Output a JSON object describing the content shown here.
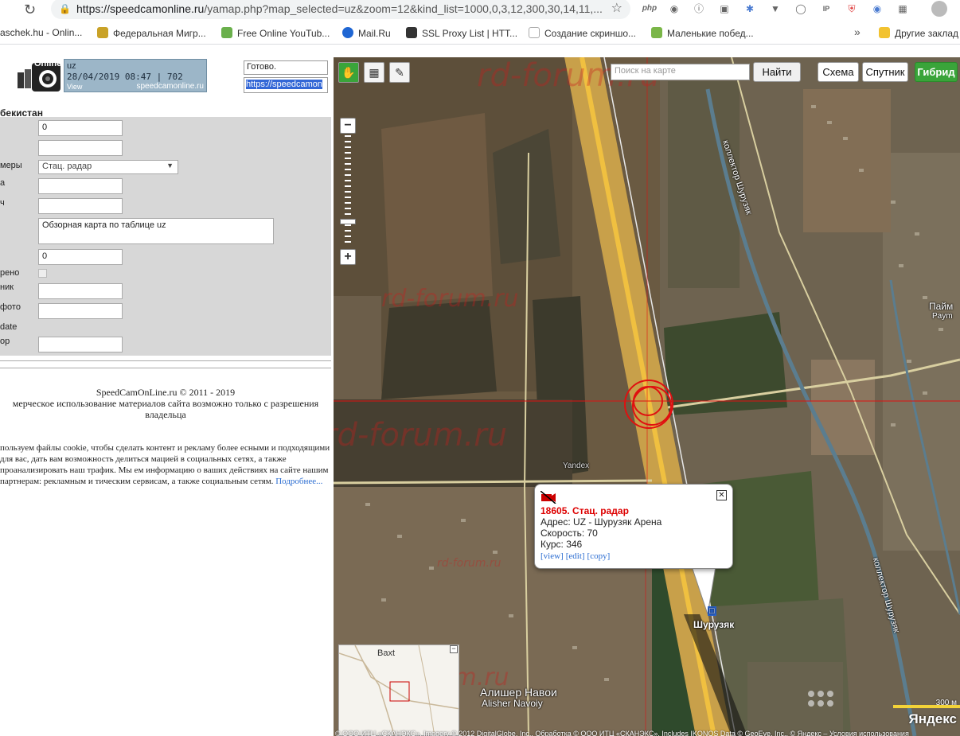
{
  "browser": {
    "url_domain": "https://speedcamonline.ru",
    "url_rest": "/yamap.php?map_selected=uz&zoom=12&kind_list=1000,0,3,12,300,30,14,11,...",
    "ext_php": "php",
    "bookmarks": [
      {
        "label": "aschek.hu - Onlin...",
        "color": "#d33"
      },
      {
        "label": "Федеральная Мигр...",
        "color": "#c9a227"
      },
      {
        "label": "Free Online YouTub...",
        "color": "#6ab04c"
      },
      {
        "label": "Mail.Ru",
        "color": "#1f66d3"
      },
      {
        "label": "SSL Proxy List | HTT...",
        "color": "#333"
      },
      {
        "label": "Создание скриншо...",
        "color": "#aaa"
      },
      {
        "label": "Маленькие побед...",
        "color": "#7ab648"
      },
      {
        "label": "Другие заклад",
        "color": "#f2c230"
      }
    ],
    "bookmarks_more": "»"
  },
  "panel": {
    "logo_text": "Online",
    "banner": {
      "line1": "uz",
      "line2": "28/04/2019 08:47 | 702",
      "view": "View",
      "site": "speedcamonline.ru"
    },
    "status": "Готово.",
    "url_field": "https://speedcamon",
    "country": "бекистан",
    "form": {
      "field1": "0",
      "field2": "",
      "type_label": "меры",
      "type_value": "Стац. радар",
      "label_a": "а",
      "label_ch": "ч",
      "description": "Обзорная карта по таблице uz",
      "field7": "0",
      "checked_label": "рено",
      "source_label": "ник",
      "photo_label": "фото",
      "date_label": "date",
      "editor_label": "ор"
    },
    "copyright": "SpeedCamOnLine.ru © 2011 - 2019",
    "copyright_note": "мерческое использование материалов сайта возможно только с разрешения владельца",
    "cookie_text": "пользуем файлы cookie, чтобы сделать контент и рекламу более есными и подходящими для вас, дать вам возможность делиться мацией в социальных сетях, а также проанализировать наш трафик. Мы ем информацию о ваших действиях на сайте нашим партнерам: рекламным и тическим сервисам, а также социальным сетям. ",
    "cookie_link": "Подробнее..."
  },
  "map": {
    "search_placeholder": "Поиск на карте",
    "find_label": "Найти",
    "types": [
      "Схема",
      "Спутник",
      "Гибрид"
    ],
    "active_type": "Гибрид",
    "watermark": "rd-forum.ru",
    "labels": {
      "canal1": "коллектор Шурузяк",
      "canal2": "коллектор Шурузяк",
      "town": "Шурузяк",
      "paym": "Пайм",
      "paym2": "Paym",
      "alisher": "Алишер Навои",
      "alisher_lat": "Alisher Navoiy",
      "yandex_small": "Yandex",
      "baxt": "Baxt"
    },
    "popup": {
      "title": "18605. Стац. радар",
      "address": "Адрес: UZ - Шурузяк Арена",
      "speed": "Скорость: 70",
      "course": "Курс: 346",
      "links": [
        "[view]",
        "[edit]",
        "[copy]"
      ]
    },
    "scale_label": "300 м",
    "brand": "Яндекс",
    "attribution": "© ООО ИТЦ «СКАНЭКС», Imagery © 2012 DigitalGlobe, Inc., Обработка © ООО ИТЦ «СКАНЭКС», Includes IKONOS Data © GeoEye, Inc., © Яндекс – Условия использования"
  }
}
